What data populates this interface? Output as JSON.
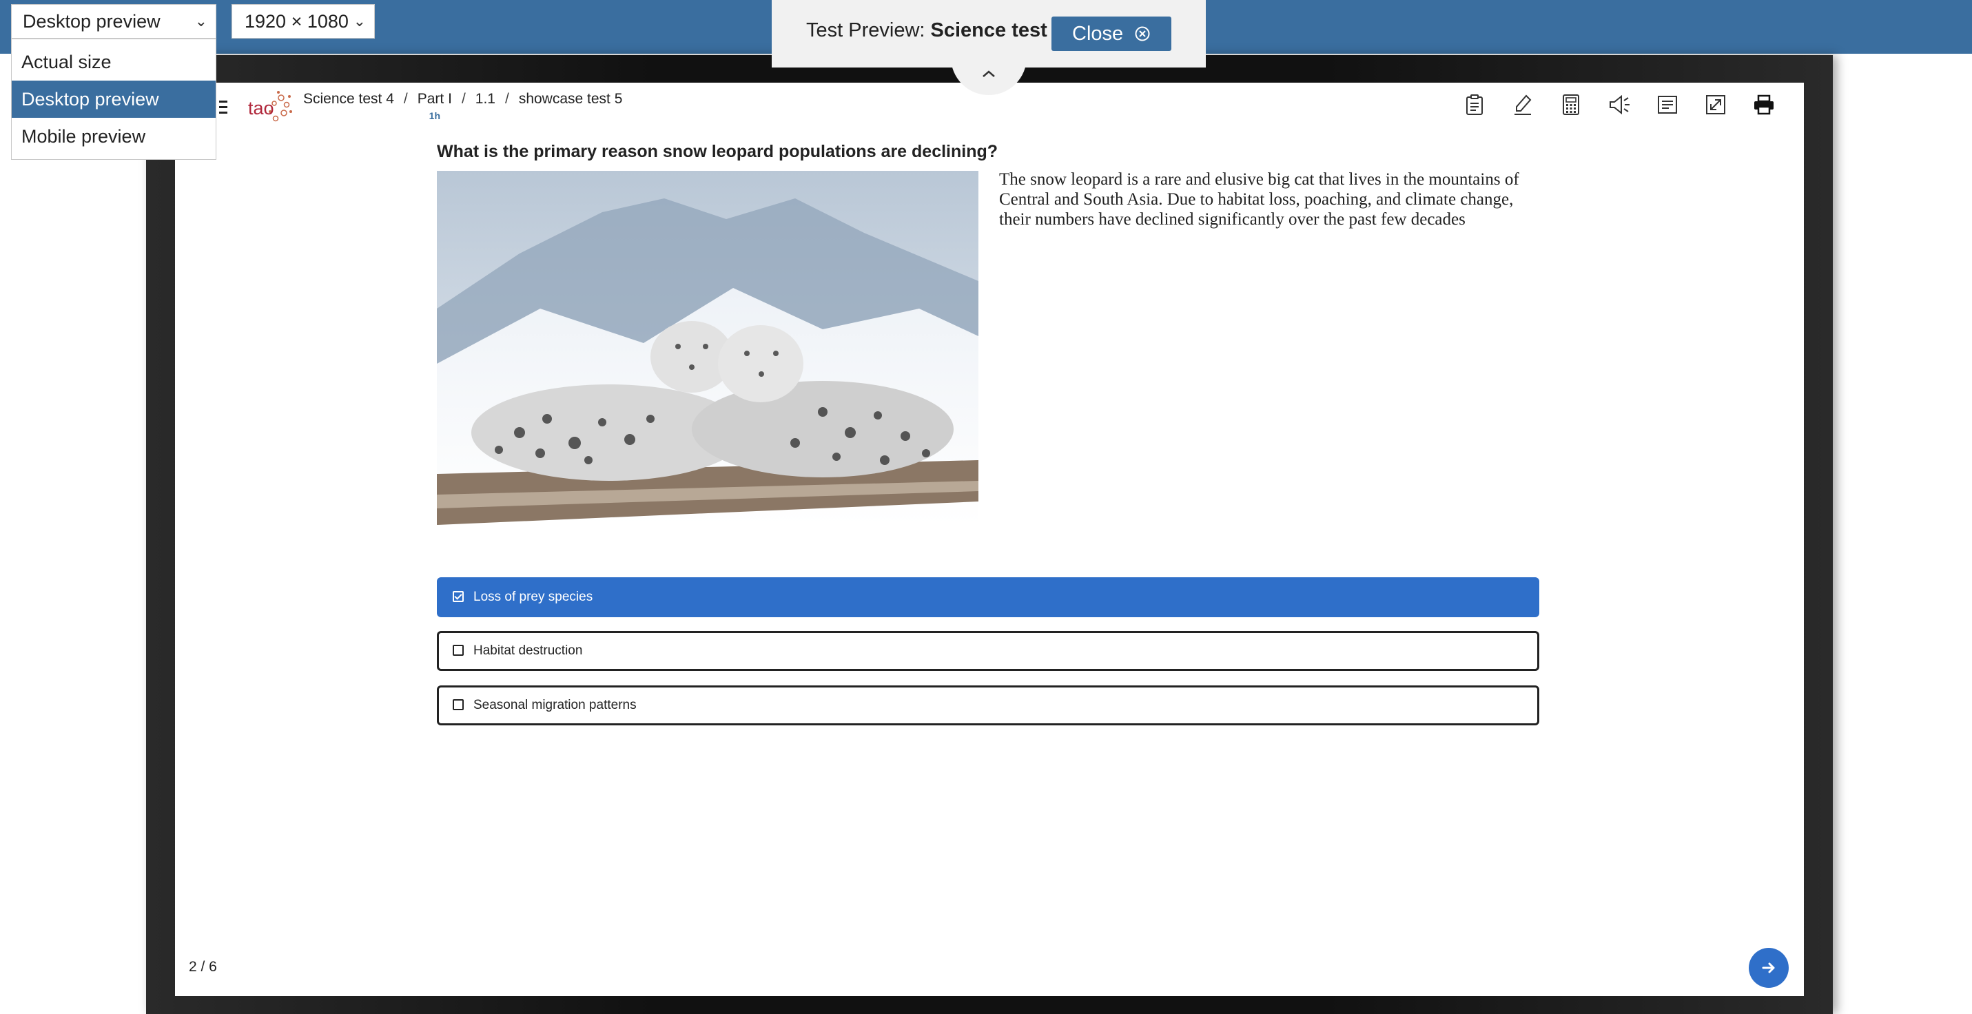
{
  "controls": {
    "mode_select": "Desktop preview",
    "resolution_select": "1920 × 1080",
    "mode_options": [
      "Actual size",
      "Desktop preview",
      "Mobile preview"
    ]
  },
  "banner": {
    "prefix": "Test Preview:",
    "test_name": "Science test 4",
    "close_label": "Close"
  },
  "header": {
    "logo_text": "tao",
    "breadcrumb": [
      "Science test 4",
      "Part I",
      "1.1",
      "showcase test 5"
    ],
    "timer": "1h"
  },
  "item": {
    "question": "What is the primary reason snow leopard populations are declining?",
    "passage": "The snow leopard is a rare and elusive big cat that lives in the mountains of Central and South Asia. Due to habitat loss, poaching, and climate change, their numbers have declined significantly over the past few decades",
    "choices": [
      {
        "label": "Loss of prey species",
        "selected": true
      },
      {
        "label": "Habitat destruction",
        "selected": false
      },
      {
        "label": "Seasonal migration patterns",
        "selected": false
      }
    ]
  },
  "footer": {
    "progress": "2 / 6"
  },
  "colors": {
    "topbar": "#3a6e9f",
    "accent": "#2f6fc9",
    "dropdown_active": "#3a6e9f"
  }
}
